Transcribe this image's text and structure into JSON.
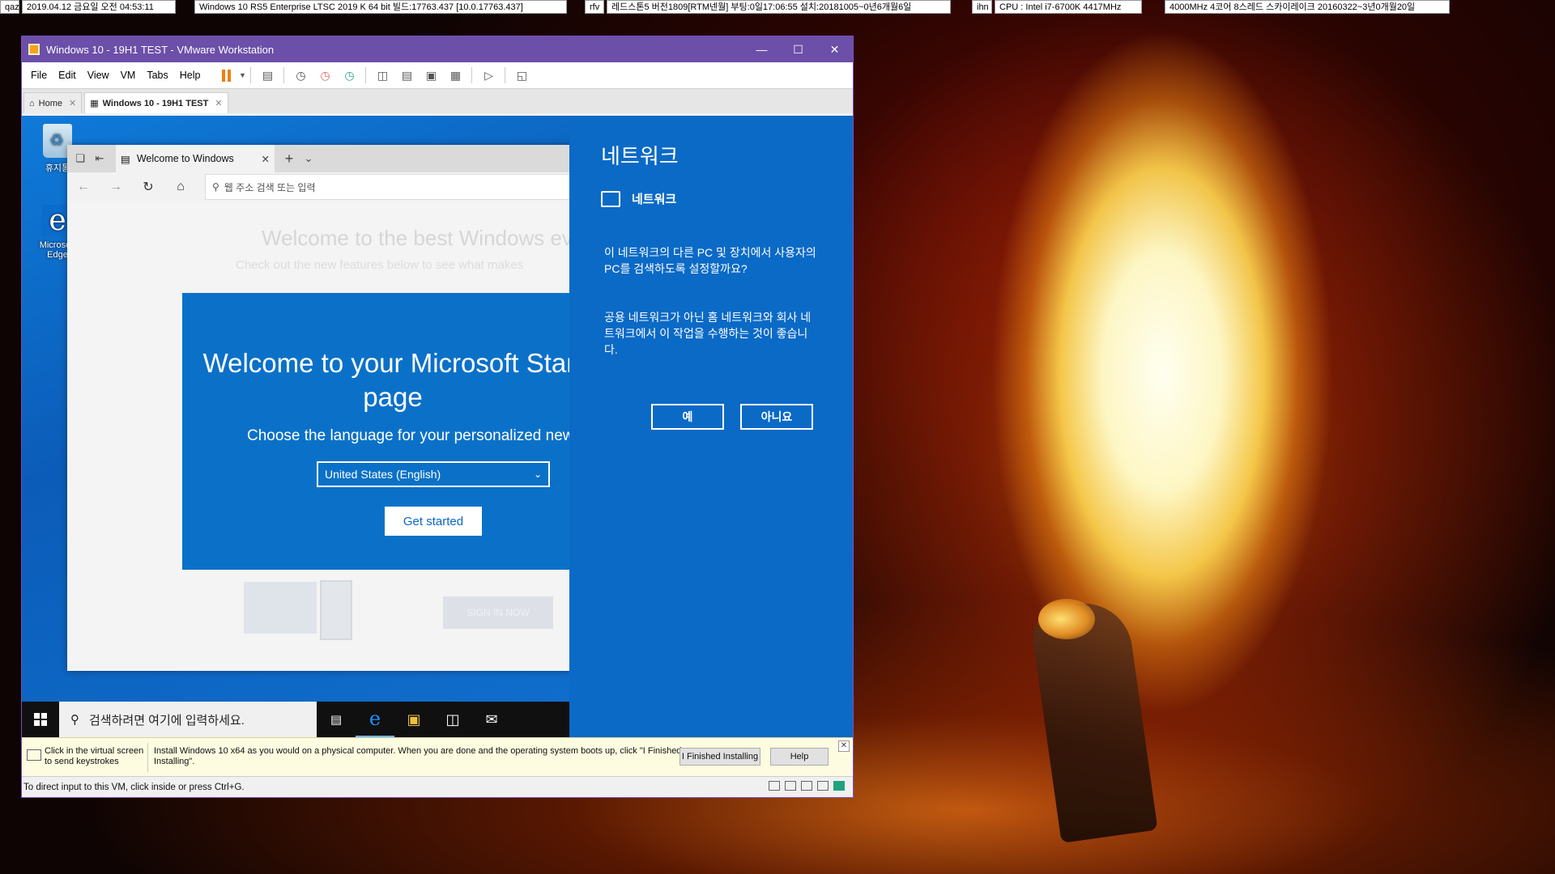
{
  "overlay": {
    "datetime": "2019.04.12 금요일 오전 04:53:11",
    "datetime_tag": "qaz",
    "os_build": "Windows 10 RS5 Enterprise LTSC 2019 K 64 bit 빌드:17763.437 [10.0.17763.437]",
    "install_tag": "rfv",
    "install_info": "레드스톤5 버전1809[RTM넨월] 부팅:0일17:06:55 설치:20181005~0년6개월6일",
    "cpu_tag": "ihn",
    "cpu": "CPU : Intel i7-6700K 4417MHz",
    "cpu_detail": "4000MHz 4코어 8스레드 스카이레이크 20160322~3년0개월20일"
  },
  "vmware": {
    "title": "Windows 10 - 19H1 TEST - VMware Workstation",
    "menu": [
      "File",
      "Edit",
      "View",
      "VM",
      "Tabs",
      "Help"
    ],
    "tabs": [
      {
        "label": "Home"
      },
      {
        "label": "Windows 10 - 19H1 TEST"
      }
    ],
    "hint_left": "Click in the virtual screen to send keystrokes",
    "hint_main": "Install Windows 10 x64 as you would on a physical computer. When you are done and the operating system boots up, click \"I Finished Installing\".",
    "finished_button": "I Finished Installing",
    "help_button": "Help",
    "status_text": "To direct input to this VM, click inside or press Ctrl+G."
  },
  "guest": {
    "desktop_icons": [
      {
        "label": "휴지통",
        "icon": "recycle-bin-icon"
      },
      {
        "label": "Microsoft Edge",
        "icon": "edge-icon"
      }
    ],
    "edge": {
      "tab_title": "Welcome to Windows",
      "address_placeholder": "웹 주소 검색 또는 입력",
      "faded_heading": "Welcome to the best Windows ever",
      "faded_sub": "Check out the new features below to see what makes",
      "faded_button": "SIGN IN NOW",
      "welcome_title": "Welcome to your Microsoft Start page",
      "welcome_sub": "Choose the language for your personalized news",
      "language_selected": "United States (English)",
      "get_started": "Get started"
    },
    "network_panel": {
      "title": "네트워크",
      "network_name": "네트워크",
      "question": "이 네트워크의 다른 PC 및 장치에서 사용자의 PC를 검색하도록 설정할까요?",
      "advice": "공용 네트워크가 아닌 홈 네트워크와 회사 네트워크에서 이 작업을 수행하는 것이 좋습니다.",
      "yes": "예",
      "no": "아니요"
    },
    "taskbar": {
      "search_placeholder": "검색하려면 여기에 입력하세요."
    }
  },
  "colors": {
    "vmware_titlebar": "#6c4fa8",
    "network_panel": "#0b6ac6",
    "welcome_box": "#0b71c8"
  }
}
